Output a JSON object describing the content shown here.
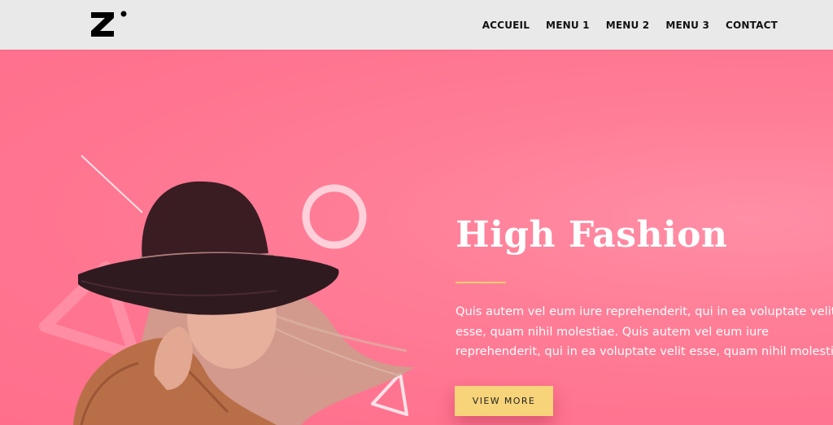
{
  "logo": {
    "text": "Z",
    "icon": "z-dot-logo-icon"
  },
  "nav": {
    "items": [
      {
        "label": "ACCUEIL"
      },
      {
        "label": "MENU 1"
      },
      {
        "label": "MENU 2"
      },
      {
        "label": "MENU 3"
      },
      {
        "label": "CONTACT"
      }
    ]
  },
  "hero": {
    "title": "High Fashion",
    "body_lines": [
      "Quis autem vel eum iure reprehenderit, qui in ea voluptate velit",
      "esse, quam nihil molestiae. Quis autem vel eum iure",
      "reprehenderit, qui in ea voluptate velit esse, quam nihil molestiae."
    ],
    "cta_label": "VIEW MORE"
  },
  "colors": {
    "header_bg": "#e9e9e9",
    "hero_bg": "#ff7490",
    "accent": "#f7d47a",
    "divider": "#f3cf6e",
    "text_light": "#ffffff"
  }
}
